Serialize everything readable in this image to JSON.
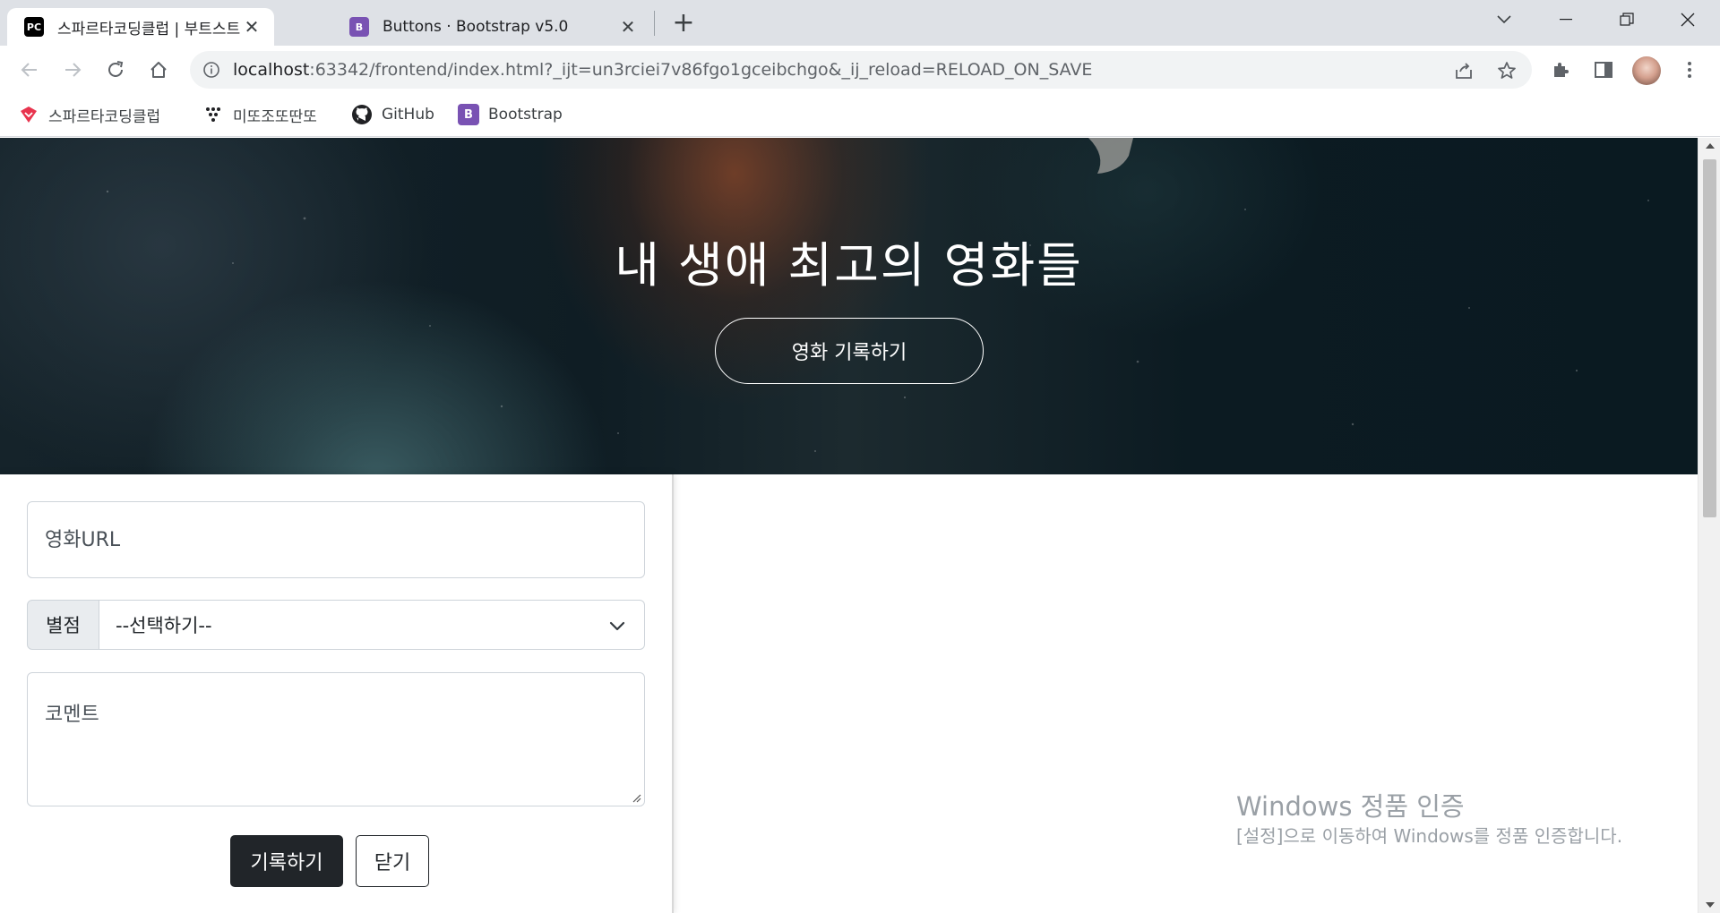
{
  "browser": {
    "tabs": [
      {
        "title": "스파르타코딩클럽 | 부트스트랩",
        "favicon": "pycharm-icon",
        "active": true
      },
      {
        "title": "Buttons · Bootstrap v5.0",
        "favicon": "bootstrap-icon",
        "active": false
      }
    ],
    "omnibox": {
      "url_host": "localhost",
      "url_rest": ":63342/frontend/index.html?_ijt=un3rciei7v86fgo1gceibchgo&_ij_reload=RELOAD_ON_SAVE"
    },
    "bookmarks": [
      {
        "label": "스파르타코딩클럽",
        "icon": "sparta-icon"
      },
      {
        "label": "미또조또딴또",
        "icon": "dots-icon"
      },
      {
        "label": "GitHub",
        "icon": "github-icon"
      },
      {
        "label": "Bootstrap",
        "icon": "bootstrap-icon"
      }
    ],
    "icon_glyphs": {
      "pycharm": "PC",
      "bootstrap": "B"
    }
  },
  "page": {
    "hero": {
      "title": "내 생애 최고의 영화들",
      "button_label": "영화 기록하기"
    },
    "form": {
      "url_placeholder": "영화URL",
      "rating_label": "별점",
      "rating_selected": "--선택하기--",
      "comment_placeholder": "코멘트",
      "submit_label": "기록하기",
      "close_label": "닫기"
    }
  },
  "watermark": {
    "title": "Windows 정품 인증",
    "subtitle": "[설정]으로 이동하여 Windows를 정품 인증합니다."
  },
  "colors": {
    "tabstrip": "#dee1e6",
    "dark_button": "#212529",
    "bootstrap_purple": "#7952b3"
  }
}
